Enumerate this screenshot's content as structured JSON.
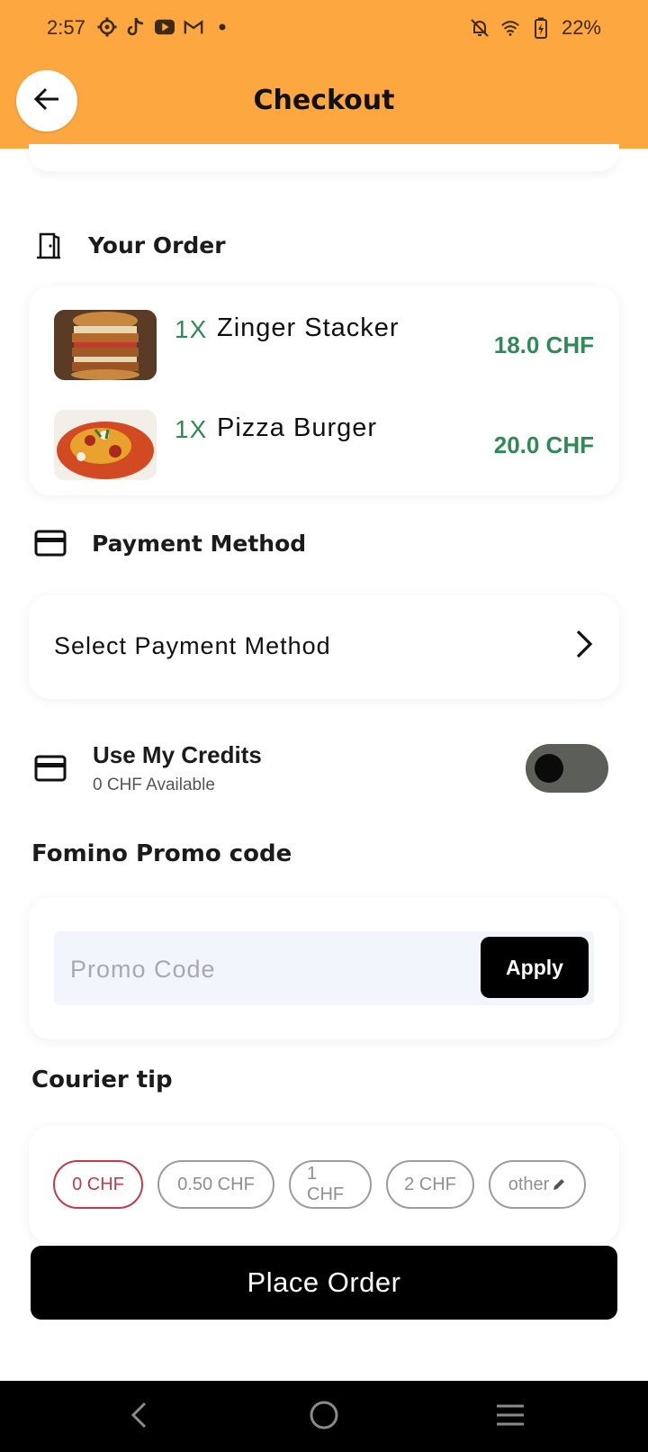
{
  "status_bar": {
    "time": "2:57",
    "battery_pct": "22%",
    "left_icons": [
      "settings-icon",
      "tiktok-icon",
      "youtube-icon",
      "gmail-icon",
      "dot-icon"
    ],
    "right_icons": [
      "mute-icon",
      "wifi-icon",
      "battery-icon"
    ]
  },
  "header": {
    "title": "Checkout",
    "color": "#fda741"
  },
  "order": {
    "section_label": "Your Order",
    "items": [
      {
        "qty": "1X",
        "name": "Zinger Stacker",
        "price": "18.0 CHF"
      },
      {
        "qty": "1X",
        "name": "Pizza Burger",
        "price": "20.0 CHF"
      }
    ]
  },
  "payment": {
    "section_label": "Payment Method",
    "select_label": "Select Payment Method"
  },
  "credits": {
    "title": "Use My Credits",
    "subtitle": "0 CHF Available",
    "toggle_on": false
  },
  "promo": {
    "section_label": "Fomino Promo code",
    "placeholder": "Promo Code",
    "value": "",
    "apply_label": "Apply"
  },
  "tip": {
    "section_label": "Courier tip",
    "options": [
      "0 CHF",
      "0.50 CHF",
      "1 CHF",
      "2 CHF",
      "other"
    ],
    "selected_index": 0
  },
  "place_order_label": "Place Order",
  "colors": {
    "accent_orange": "#fda741",
    "price_green": "#2e8b57",
    "tip_selected": "#c4394b"
  }
}
